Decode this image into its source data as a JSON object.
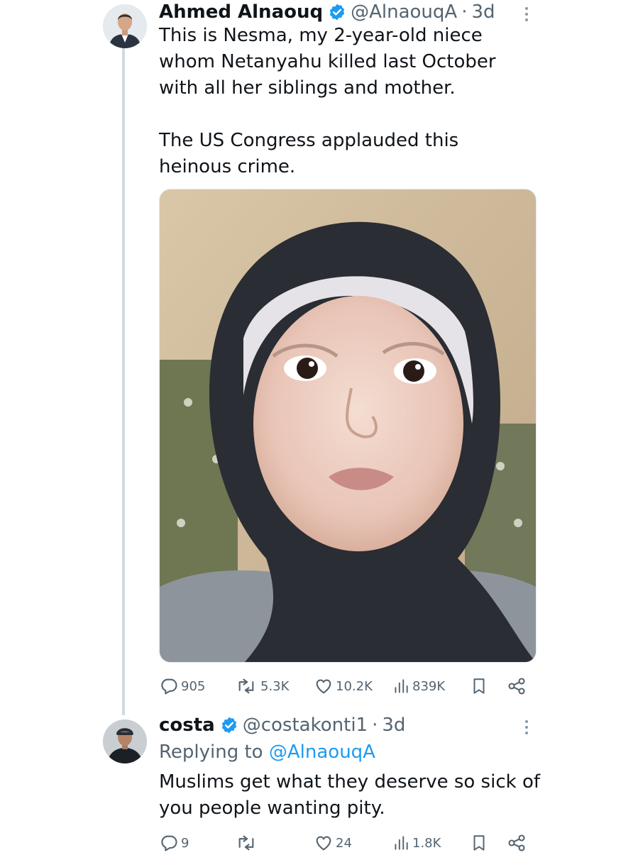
{
  "thread": [
    {
      "author": {
        "name": "Ahmed Alnaouq",
        "handle": "@AlnaouqA",
        "verified": true
      },
      "separator": "·",
      "time": "3d",
      "text": "This is Nesma, my 2-year-old niece\nwhom Netanyahu killed last October\nwith all her siblings and mother.\n\nThe US Congress applauded this\nheinous crime.",
      "media": {
        "type": "photo"
      },
      "stats": {
        "replies": "905",
        "reposts": "5.3K",
        "likes": "10.2K",
        "views": "839K"
      }
    },
    {
      "author": {
        "name": "costa",
        "handle": "@costakonti1",
        "verified": true
      },
      "separator": "·",
      "time": "3d",
      "replying_prefix": "Replying to ",
      "replying_to": "@AlnaouqA",
      "text": "Muslims get what they deserve so sick of\nyou people wanting pity.",
      "stats": {
        "replies": "9",
        "reposts": "",
        "likes": "24",
        "views": "1.8K"
      }
    }
  ],
  "icons": {
    "reply": "reply-icon",
    "repost": "repost-icon",
    "like": "heart-icon",
    "views": "views-icon",
    "bookmark": "bookmark-icon",
    "share": "share-icon",
    "more": "more-icon",
    "verified": "verified-badge-icon"
  },
  "colors": {
    "text": "#0f1419",
    "secondary": "#536471",
    "accent": "#1d9bf0",
    "thread_line": "#cfd9de"
  }
}
